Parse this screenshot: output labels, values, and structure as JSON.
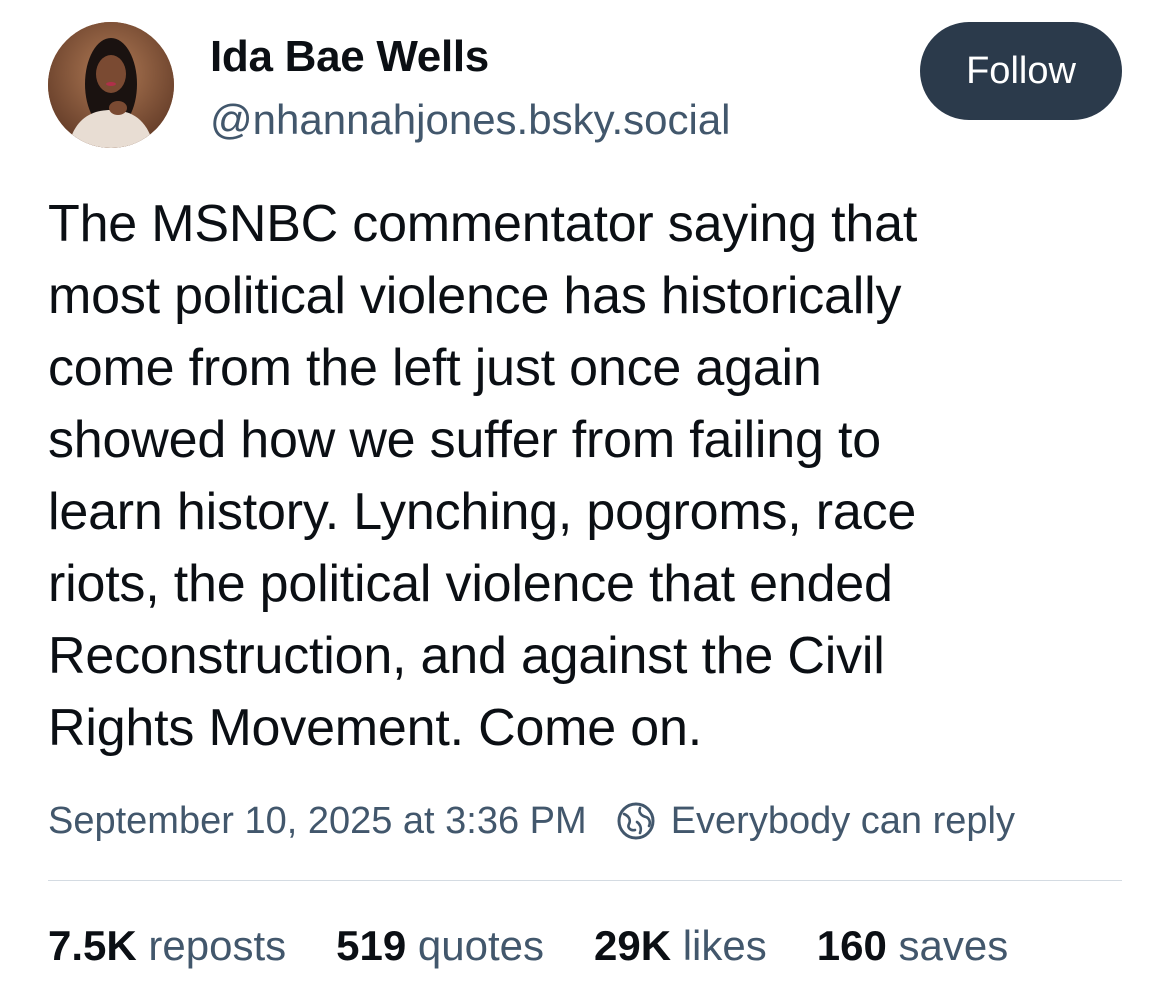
{
  "author": {
    "name": "Ida Bae Wells",
    "handle": "@nhannahjones.bsky.social"
  },
  "follow_label": "Follow",
  "post": {
    "text": "The MSNBC commentator saying that\nmost political violence has historically\ncome from the left just once again\nshowed how we suffer from failing to\nlearn history. Lynching, pogroms, race\nriots, the political violence that ended\nReconstruction, and against the Civil\nRights Movement. Come on.",
    "timestamp": "September 10, 2025 at 3:36 PM",
    "reply_setting": "Everybody can reply",
    "reply_icon": "globe-icon"
  },
  "stats": {
    "reposts": {
      "count": "7.5K",
      "label": "reposts"
    },
    "quotes": {
      "count": "519",
      "label": "quotes"
    },
    "likes": {
      "count": "29K",
      "label": "likes"
    },
    "saves": {
      "count": "160",
      "label": "saves"
    }
  },
  "colors": {
    "primary_text": "#0b0f14",
    "secondary_text": "#42576c",
    "follow_button_bg": "#2b3a4b",
    "divider": "#d4dbe2"
  }
}
